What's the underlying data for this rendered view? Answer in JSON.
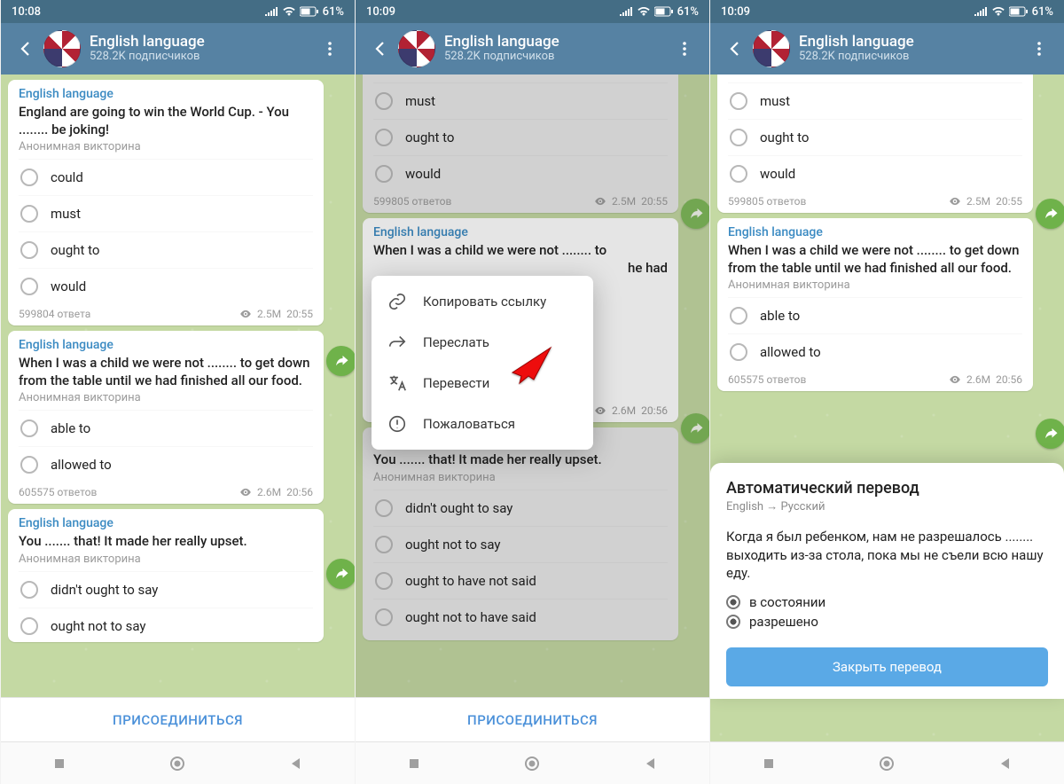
{
  "screens": [
    {
      "time": "10:08",
      "battery": "61%"
    },
    {
      "time": "10:09",
      "battery": "61%"
    },
    {
      "time": "10:09",
      "battery": "61%"
    }
  ],
  "header": {
    "title": "English language",
    "subtitle": "528.2K подписчиков"
  },
  "poll1": {
    "sender": "English language",
    "question": "England are going to win the World Cup. - You ........ be joking!",
    "caption": "Анонимная викторина",
    "options": [
      "could",
      "must",
      "ought to",
      "would"
    ],
    "answers_a": "599804 ответа",
    "answers_b": "599805 ответов",
    "views": "2.5M",
    "time": "20:55"
  },
  "poll2": {
    "sender": "English language",
    "question": "When I was a child we were not ........ to get down from the table until we had finished all our food.",
    "question_short": "When I was a child we were not ........ to",
    "caption": "Анонимная викторина",
    "options": [
      "able to",
      "allowed to"
    ],
    "answers": "605575 ответов",
    "views": "2.6M",
    "time": "20:56"
  },
  "poll3": {
    "sender": "English language",
    "question": "You ....... that! It made her really upset.",
    "caption": "Анонимная викторина",
    "options": [
      "didn't ought to say",
      "ought not to say",
      "ought to have not said",
      "ought not to have said"
    ]
  },
  "join_label": "ПРИСОЕДИНИТЬСЯ",
  "context_menu": {
    "copy": "Копировать ссылку",
    "forward": "Переслать",
    "translate": "Перевести",
    "report": "Пожаловаться"
  },
  "translate_panel": {
    "title": "Автоматический перевод",
    "sub": "English → Русский",
    "body": "Когда я был ребенком, нам не разрешалось ........ выходить из-за стола, пока мы не съели всю нашу еду.",
    "opts": [
      "в состоянии",
      "разрешено"
    ],
    "close": "Закрыть перевод"
  },
  "ctx_line2": "he had"
}
